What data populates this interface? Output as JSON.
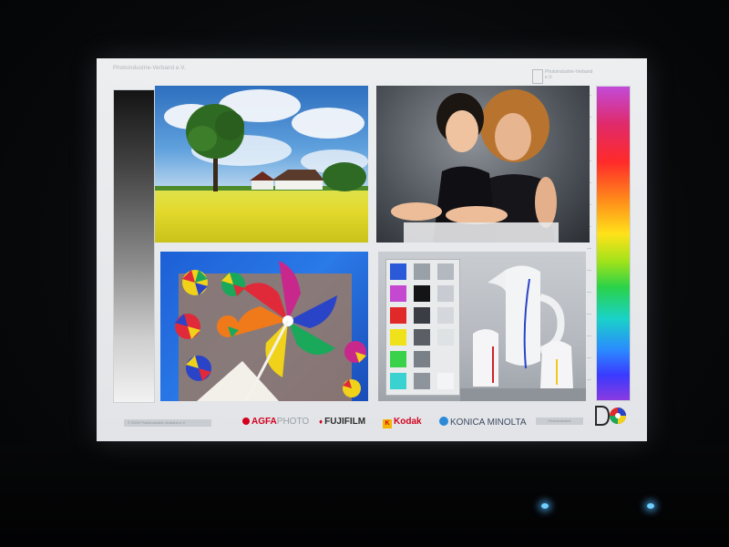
{
  "screen": {
    "header_line": "Photoindustrie-Verband e.V.",
    "brand_text": "Photoindustrie-Verband e.V.",
    "copyright": "© 2005 Photoindustrie-Verband e.V.",
    "footer_right": "Photoindustrie"
  },
  "logos": [
    {
      "name": "AGFAPHOTO",
      "prefix": "AGFA",
      "suffix": "PHOTO",
      "color": "#d2001e"
    },
    {
      "name": "FUJIFILM",
      "text": "FUJIFILM",
      "color": "#d2001e"
    },
    {
      "name": "Kodak",
      "text": "Kodak",
      "color": "#d2001e"
    },
    {
      "name": "KONICA MINOLTA",
      "text": "KONICA MINOLTA",
      "color": "#3c4a60"
    }
  ],
  "colors": {
    "accent_red": "#d2001e",
    "led": "#6fd0ff"
  }
}
